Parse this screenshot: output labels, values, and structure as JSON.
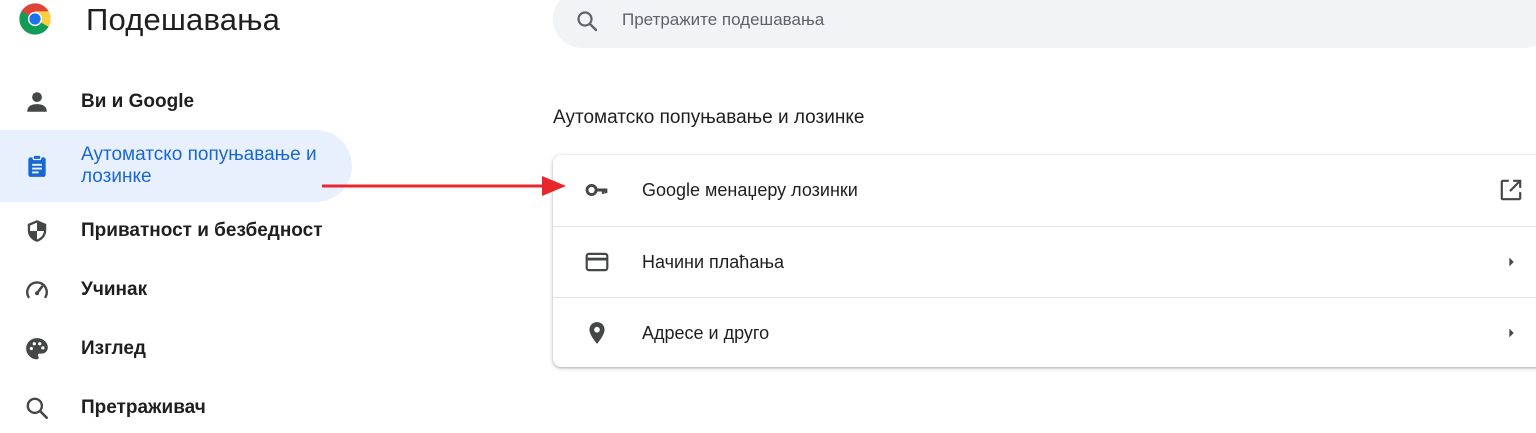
{
  "app": {
    "title": "Подешавања"
  },
  "search": {
    "placeholder": "Претражите подешавања"
  },
  "sidebar": {
    "items": [
      {
        "label": "Ви и Google",
        "icon": "person-icon"
      },
      {
        "label": "Аутоматско попуњавање и лозинке",
        "icon": "clipboard-icon",
        "active": true
      },
      {
        "label": "Приватност и безбедност",
        "icon": "shield-icon"
      },
      {
        "label": "Учинак",
        "icon": "speedometer-icon"
      },
      {
        "label": "Изглед",
        "icon": "palette-icon"
      },
      {
        "label": "Претраживач",
        "icon": "search-icon"
      }
    ]
  },
  "main": {
    "section_title": "Аутоматско попуњавање и лозинке",
    "rows": [
      {
        "label": "Google менаџеру лозинки",
        "icon": "key-icon",
        "action": "open-external-icon"
      },
      {
        "label": "Начини плаћања",
        "icon": "credit-card-icon",
        "action": "arrow-right-icon"
      },
      {
        "label": "Адресе и друго",
        "icon": "location-pin-icon",
        "action": "arrow-right-icon"
      }
    ]
  },
  "colors": {
    "accent": "#1967d2",
    "active_bg": "#e8f0fe",
    "icon_gray": "#5f6368",
    "annotation_red": "#e8262b"
  }
}
